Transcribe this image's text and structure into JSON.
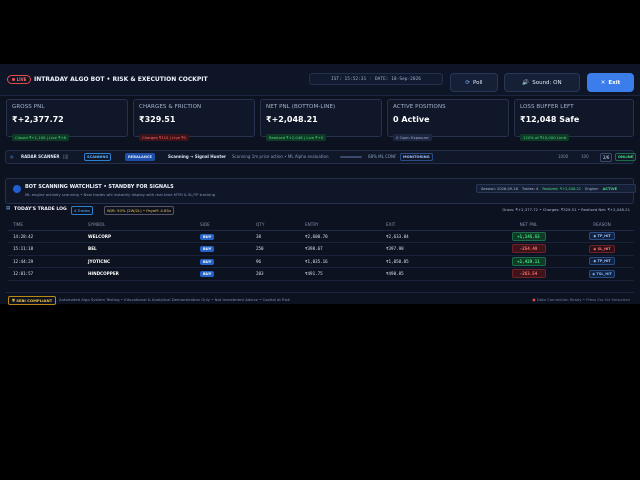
{
  "header": {
    "live": "LIVE",
    "title": "INTRADAY ALGO BOT • RISK & EXECUTION COCKPIT",
    "ist": "IST: 15:52:31",
    "date": "DATE: 18-Sep-2026",
    "poll": "Poll",
    "sound": "Sound: ON",
    "exit": "Exit"
  },
  "cards": [
    {
      "label": "GROSS PNL",
      "value": "₹+2,377.72",
      "sub": "Closed ₹+1,100 | Live ₹+6",
      "tone": "green"
    },
    {
      "label": "CHARGES & FRICTION",
      "value": "₹329.51",
      "sub": "Charges ₹110 | Live ₹0",
      "tone": "red"
    },
    {
      "label": "NET PNL (BOTTOM-LINE)",
      "value": "₹+2,048.21",
      "sub": "Realized ₹+2,048 | Live ₹+0",
      "tone": "green"
    },
    {
      "label": "ACTIVE POSITIONS",
      "value": "0 Active",
      "sub": "0 Open Exposure",
      "tone": "gray"
    },
    {
      "label": "LOSS BUFFER LEFT",
      "value": "₹12,048 Safe",
      "sub": "120% of ₹10,000 Limit",
      "tone": "green"
    }
  ],
  "scanner": {
    "label": "RADAR SCANNER",
    "state": "SCANNING",
    "phase": "REBALANCE",
    "hunter": "Scanning → Signal Hunter",
    "detail": "Scanning 1m price action • ML Alpha evaluation",
    "conf": "68% ML CONF",
    "mode": "MONITORING",
    "r1": "1000",
    "r2": "100",
    "count": "2/6",
    "status": "ONLINE"
  },
  "watchlist": {
    "title": "BOT SCANNING WATCHLIST • STANDBY FOR SIGNALS",
    "sub": "ML engine actively scanning • New trades will instantly display with real-time MTM & SL/TP tracking",
    "session": "Session: 2026-09-18",
    "trades": "Trades: 4",
    "realized": "Realized: ₹+2,048.21",
    "engine": "Engine:",
    "engine_state": "ACTIVE"
  },
  "trade_log": {
    "title": "TODAY'S TRADE LOG",
    "count_badge": "4 Trades",
    "winrate_badge": "W/R: 50% (2W/2L) • Payoff: 4.85x",
    "summary": "Gross: ₹+2,377.72   •   Charges: ₹329.51   •   Realized Net: ₹+2,048.21",
    "columns": [
      "TIME",
      "SYMBOL",
      "SIDE",
      "QTY",
      "ENTRY",
      "EXIT",
      "NET PNL",
      "REASON"
    ],
    "rows": [
      {
        "time": "14:28:42",
        "symbol": "WELCORP",
        "side": "BUY",
        "qty": "38",
        "entry": "₹2,600.70",
        "exit": "₹2,633.04",
        "pnl": "+1,145.55",
        "pnl_tone": "pos",
        "reason": "TP_HIT",
        "reason_tone": "tp"
      },
      {
        "time": "15:11:18",
        "symbol": "BEL",
        "side": "BUY",
        "qty": "250",
        "entry": "₹398.67",
        "exit": "₹397.98",
        "pnl": "-254.49",
        "pnl_tone": "neg",
        "reason": "SL_HIT",
        "reason_tone": "sl"
      },
      {
        "time": "12:44:29",
        "symbol": "JYOTICNC",
        "side": "BUY",
        "qty": "96",
        "entry": "₹1,035.16",
        "exit": "₹1,050.85",
        "pnl": "+1,429.11",
        "pnl_tone": "pos",
        "reason": "TP_HIT",
        "reason_tone": "tp"
      },
      {
        "time": "12:01:57",
        "symbol": "HINDCOPPER",
        "side": "BUY",
        "qty": "203",
        "entry": "₹491.75",
        "exit": "₹490.85",
        "pnl": "-263.54",
        "pnl_tone": "neg",
        "reason": "TSL_HIT",
        "reason_tone": "tsl"
      }
    ]
  },
  "footer": {
    "badge": "SEBI COMPLIANT",
    "text": "Automated Algo System Testing • Educational & Analytical Demonstration Only • Not Investment Advice • Capital at Risk",
    "right": "Data Connection Ready  •  Press Esc for fullscreen"
  }
}
